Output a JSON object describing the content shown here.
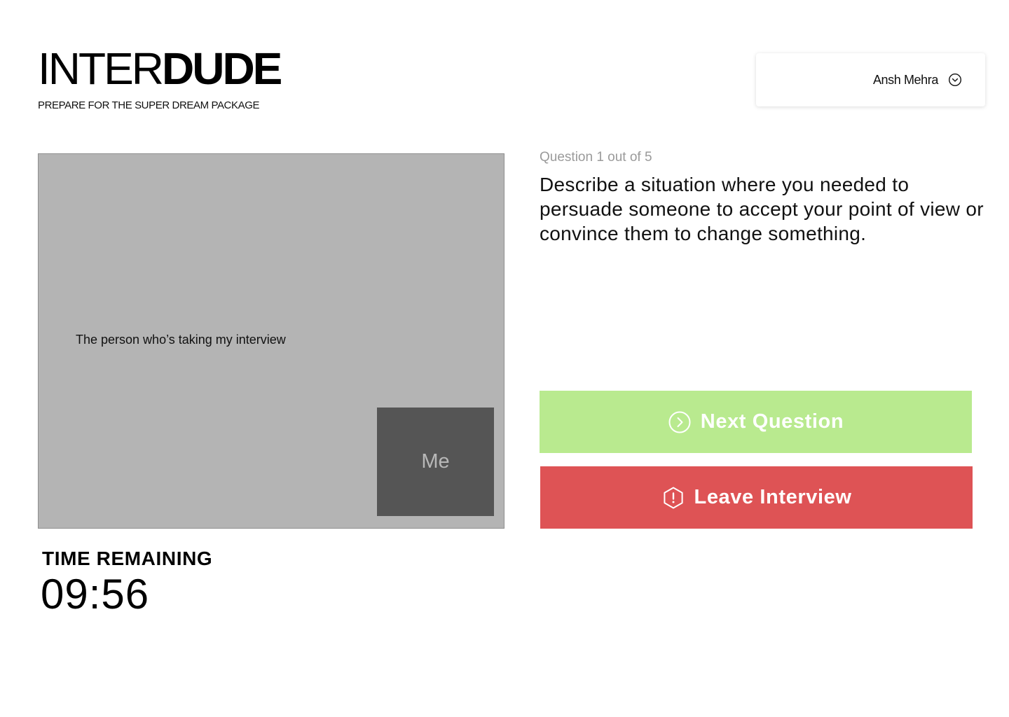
{
  "brand": {
    "logo_light": "INTER",
    "logo_bold": "DUDE",
    "tagline": "PREPARE FOR THE SUPER DREAM PACKAGE"
  },
  "user_menu": {
    "name": "Ansh Mehra",
    "icon": "chevron-down-circle-icon"
  },
  "video": {
    "interviewer_label": "The person who’s taking my interview",
    "self_label": "Me"
  },
  "timer": {
    "title": "TIME REMAINING",
    "value": "09:56"
  },
  "question": {
    "counter": "Question 1 out of 5",
    "text": "Describe a situation where you needed to persuade someone to accept your point of view or convince them to change something."
  },
  "actions": {
    "next_label": "Next Question",
    "next_icon": "chevron-right-circle-icon",
    "leave_label": "Leave Interview",
    "leave_icon": "alert-hexagon-icon"
  },
  "colors": {
    "next_button": "#b9ea8f",
    "leave_button": "#de5355",
    "video_background": "#b4b4b4",
    "self_view_background": "#555555",
    "counter_text": "#9a9a9a"
  }
}
